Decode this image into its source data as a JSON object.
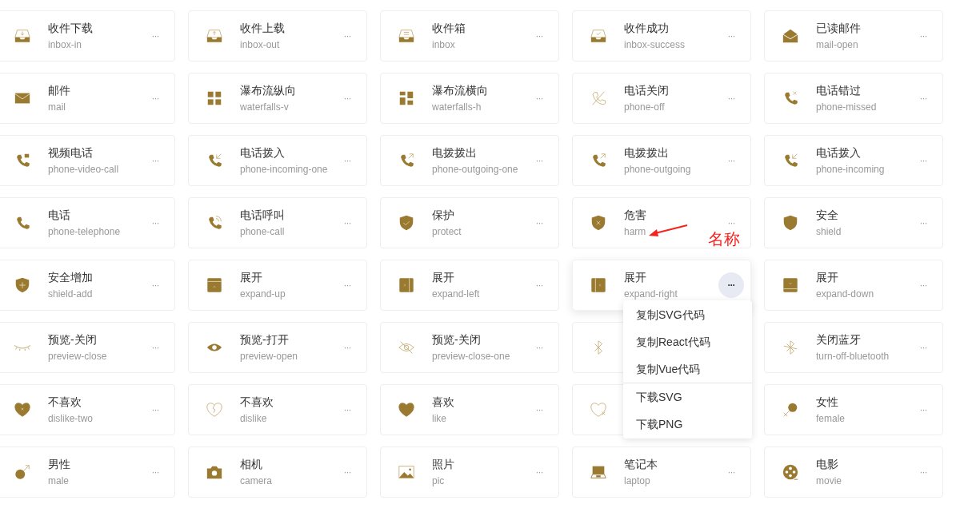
{
  "cards": [
    {
      "title": "收件下载",
      "name": "inbox-in",
      "active": false
    },
    {
      "title": "收件上载",
      "name": "inbox-out",
      "active": false
    },
    {
      "title": "收件箱",
      "name": "inbox",
      "active": false
    },
    {
      "title": "收件成功",
      "name": "inbox-success",
      "active": false
    },
    {
      "title": "已读邮件",
      "name": "mail-open",
      "active": false
    },
    {
      "title": "邮件",
      "name": "mail",
      "active": false
    },
    {
      "title": "瀑布流纵向",
      "name": "waterfalls-v",
      "active": false
    },
    {
      "title": "瀑布流横向",
      "name": "waterfalls-h",
      "active": false
    },
    {
      "title": "电话关闭",
      "name": "phone-off",
      "active": false
    },
    {
      "title": "电话错过",
      "name": "phone-missed",
      "active": false
    },
    {
      "title": "视频电话",
      "name": "phone-video-call",
      "active": false
    },
    {
      "title": "电话拨入",
      "name": "phone-incoming-one",
      "active": false
    },
    {
      "title": "电拨拨出",
      "name": "phone-outgoing-one",
      "active": false
    },
    {
      "title": "电拨拨出",
      "name": "phone-outgoing",
      "active": false
    },
    {
      "title": "电话拨入",
      "name": "phone-incoming",
      "active": false
    },
    {
      "title": "电话",
      "name": "phone-telephone",
      "active": false
    },
    {
      "title": "电话呼叫",
      "name": "phone-call",
      "active": false
    },
    {
      "title": "保护",
      "name": "protect",
      "active": false
    },
    {
      "title": "危害",
      "name": "harm",
      "active": false,
      "annotation": "名称"
    },
    {
      "title": "安全",
      "name": "shield",
      "active": false
    },
    {
      "title": "安全增加",
      "name": "shield-add",
      "active": false
    },
    {
      "title": "展开",
      "name": "expand-up",
      "active": false
    },
    {
      "title": "展开",
      "name": "expand-left",
      "active": false
    },
    {
      "title": "展开",
      "name": "expand-right",
      "active": true
    },
    {
      "title": "展开",
      "name": "expand-down",
      "active": false
    },
    {
      "title": "预览-关闭",
      "name": "preview-close",
      "active": false
    },
    {
      "title": "预览-打开",
      "name": "preview-open",
      "active": false
    },
    {
      "title": "预览-关闭",
      "name": "preview-close-one",
      "active": false
    },
    {
      "active": false
    },
    {
      "title": "关闭蓝牙",
      "name": "turn-off-bluetooth",
      "active": false
    },
    {
      "title": "不喜欢",
      "name": "dislike-two",
      "active": false
    },
    {
      "title": "不喜欢",
      "name": "dislike",
      "active": false
    },
    {
      "title": "喜欢",
      "name": "like",
      "active": false
    },
    {
      "active": false
    },
    {
      "title": "女性",
      "name": "female",
      "active": false
    },
    {
      "title": "男性",
      "name": "male",
      "active": false
    },
    {
      "title": "相机",
      "name": "camera",
      "active": false
    },
    {
      "title": "照片",
      "name": "pic",
      "active": false
    },
    {
      "title": "笔记本",
      "name": "laptop",
      "active": false
    },
    {
      "title": "电影",
      "name": "movie",
      "active": false
    }
  ],
  "more_label": "···",
  "menu": [
    {
      "label": "复制SVG代码",
      "divider_before": false
    },
    {
      "label": "复制React代码",
      "divider_before": false
    },
    {
      "label": "复制Vue代码",
      "divider_before": false
    },
    {
      "label": "下载SVG",
      "divider_before": true
    },
    {
      "label": "下载PNG",
      "divider_before": false
    }
  ]
}
